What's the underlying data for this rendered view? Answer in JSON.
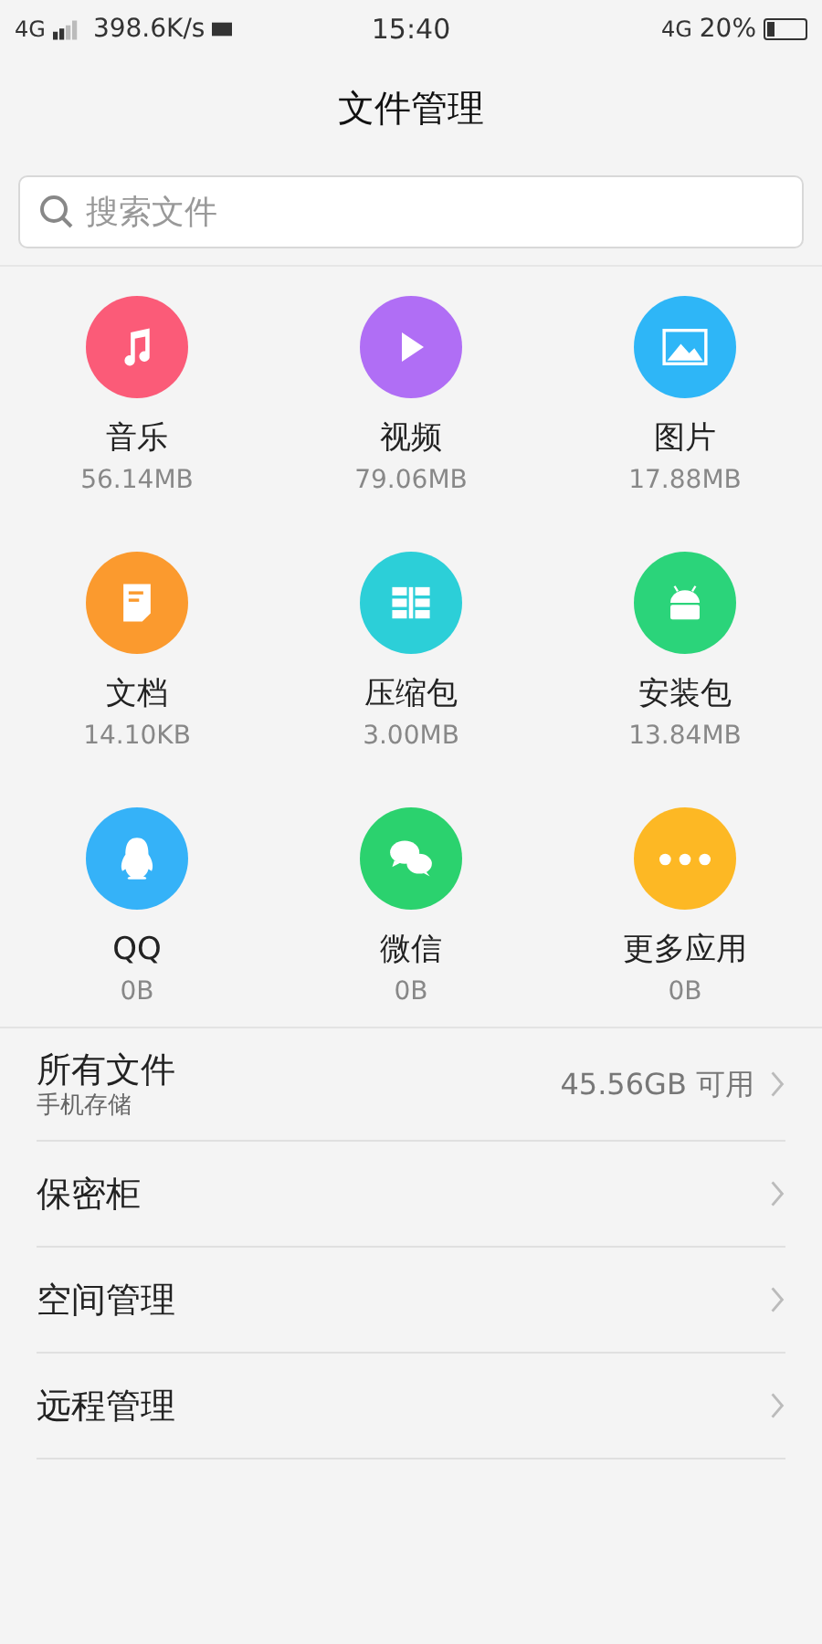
{
  "status_bar": {
    "network": "4G",
    "speed": "398.6K/s",
    "time": "15:40",
    "network_right": "4G",
    "battery": "20%"
  },
  "header": {
    "title": "文件管理"
  },
  "search": {
    "placeholder": "搜索文件"
  },
  "categories": [
    {
      "kind": "music",
      "label": "音乐",
      "size": "56.14MB",
      "color": "#fb5b78"
    },
    {
      "kind": "video",
      "label": "视频",
      "size": "79.06MB",
      "color": "#b06ef5"
    },
    {
      "kind": "image",
      "label": "图片",
      "size": "17.88MB",
      "color": "#2eb6f7"
    },
    {
      "kind": "document",
      "label": "文档",
      "size": "14.10KB",
      "color": "#fb9a2e"
    },
    {
      "kind": "archive",
      "label": "压缩包",
      "size": "3.00MB",
      "color": "#2ccfd8"
    },
    {
      "kind": "apk",
      "label": "安装包",
      "size": "13.84MB",
      "color": "#2bd47a"
    },
    {
      "kind": "qq",
      "label": "QQ",
      "size": "0B",
      "color": "#35b2f8"
    },
    {
      "kind": "wechat",
      "label": "微信",
      "size": "0B",
      "color": "#2bd26e"
    },
    {
      "kind": "more",
      "label": "更多应用",
      "size": "0B",
      "color": "#fdb824"
    }
  ],
  "list": [
    {
      "label": "所有文件",
      "sublabel": "手机存储",
      "value": "45.56GB 可用"
    },
    {
      "label": "保密柜"
    },
    {
      "label": "空间管理"
    },
    {
      "label": "远程管理"
    }
  ]
}
